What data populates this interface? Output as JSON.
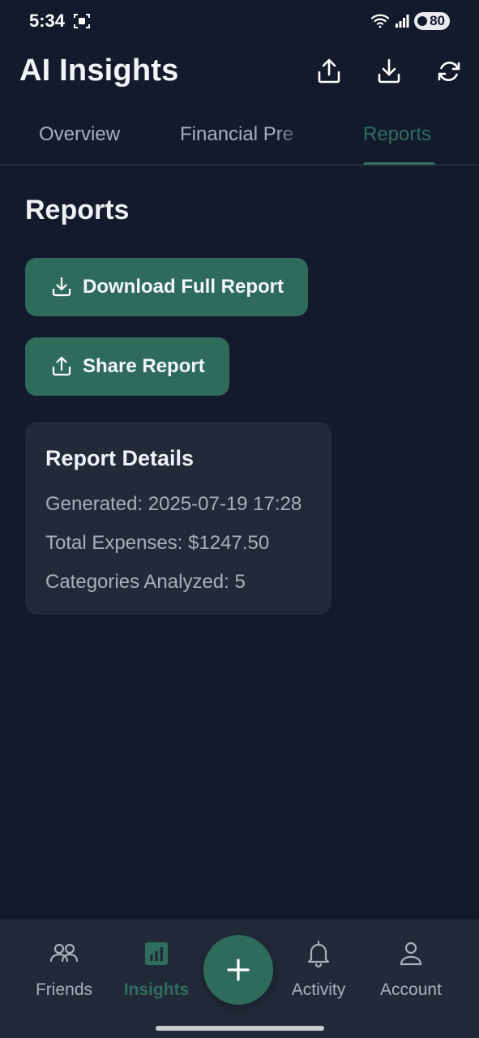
{
  "status_bar": {
    "time": "5:34",
    "battery": "80"
  },
  "header": {
    "title": "AI Insights",
    "actions": {
      "share": "share-icon",
      "download": "download-icon",
      "refresh": "refresh-icon"
    }
  },
  "tabs": [
    {
      "label": "Overview",
      "active": false
    },
    {
      "label": "Financial Pre",
      "active": false
    },
    {
      "label": "Reports",
      "active": true
    }
  ],
  "main": {
    "section_title": "Reports",
    "download_button": "Download Full Report",
    "share_button": "Share Report",
    "details_card": {
      "title": "Report Details",
      "generated": "Generated: 2025-07-19 17:28",
      "total_expenses": "Total Expenses: $1247.50",
      "categories": "Categories Analyzed: 5"
    }
  },
  "bottom_nav": {
    "items": [
      {
        "label": "Friends",
        "icon": "friends-icon",
        "active": false
      },
      {
        "label": "Insights",
        "icon": "insights-icon",
        "active": true
      },
      {
        "label": "Activity",
        "icon": "bell-icon",
        "active": false
      },
      {
        "label": "Account",
        "icon": "account-icon",
        "active": false
      }
    ],
    "fab_icon": "plus-icon"
  },
  "colors": {
    "background": "#131a2b",
    "surface": "#222a3a",
    "accent": "#2f6b5b",
    "accent_text": "#2f6e5d",
    "text_primary": "#eef1f6",
    "text_secondary": "#a9b0bc"
  }
}
